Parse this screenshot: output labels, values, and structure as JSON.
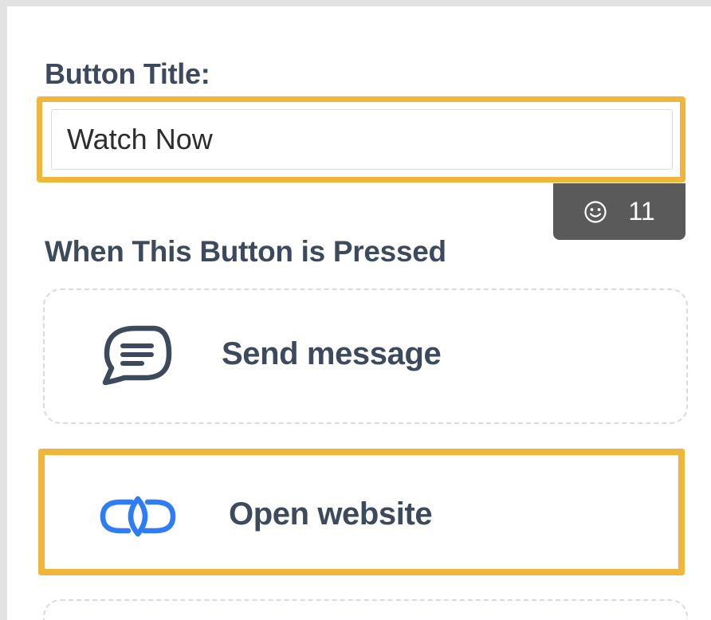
{
  "form": {
    "button_title_label": "Button Title:",
    "button_title_value": "Watch Now",
    "emoji_icon": "smiley-icon",
    "char_count": "11",
    "pressed_section_label": "When This Button is Pressed"
  },
  "actions": [
    {
      "label": "Send message",
      "icon": "message-bubble-icon",
      "selected": false
    },
    {
      "label": "Open website",
      "icon": "link-icon",
      "selected": true
    }
  ],
  "colors": {
    "highlight": "#f0b63c",
    "label_text": "#3d4a5c",
    "link_icon": "#2e7cf6",
    "badge_bg": "#5a5a5a",
    "dashed_border": "#d6dbe2"
  }
}
